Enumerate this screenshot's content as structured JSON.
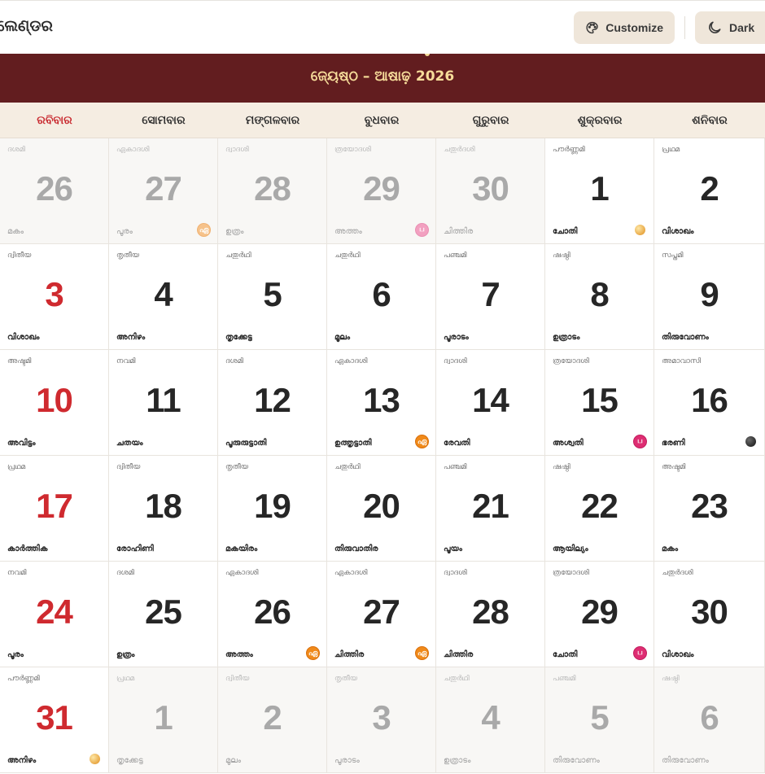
{
  "app": {
    "title": "ଲେଣ୍ଡର"
  },
  "toolbar": {
    "customize_label": "Customize",
    "customize_icon": "palette-icon",
    "dark_label": "Dark",
    "dark_icon": "moon-icon"
  },
  "month": {
    "title": "ଜ୍ୟେଷ୍ଠ – ଆଷାଢ଼ 2026"
  },
  "weekdays": [
    "ରବିବାର",
    "ସୋମବାର",
    "ମଙ୍ଗଳବାର",
    "ବୁଧବାର",
    "ଗୁରୁବାର",
    "ଶୁକ୍ରବାର",
    "ଶନିବାର"
  ],
  "colors": {
    "header_bg": "#621d1f",
    "header_text": "#f6dc9a",
    "sunday": "#cf2a2f",
    "weekday_bar": "#f5ede2",
    "badge_orange": "#f08a1a",
    "badge_pink": "#de2d72"
  },
  "days": [
    {
      "tithi": "ദശമി",
      "day": "26",
      "nakshatra": "മകം",
      "other": true
    },
    {
      "tithi": "ഏകാദശി",
      "day": "27",
      "nakshatra": "പൂരം",
      "other": true,
      "badge": {
        "text": "ഏ",
        "color": "orange"
      }
    },
    {
      "tithi": "ദ്വാദശി",
      "day": "28",
      "nakshatra": "ഉത്രം",
      "other": true
    },
    {
      "tithi": "ത്രയോദശി",
      "day": "29",
      "nakshatra": "അത്തം",
      "other": true,
      "badge": {
        "text": "ப",
        "color": "pink"
      }
    },
    {
      "tithi": "ചതുർദശി",
      "day": "30",
      "nakshatra": "ചിത്തിര",
      "other": true
    },
    {
      "tithi": "പൗർണ്ണമി",
      "day": "1",
      "nakshatra": "ചോതി",
      "moon": "full"
    },
    {
      "tithi": "പ്രഥമ",
      "day": "2",
      "nakshatra": "വിശാഖം"
    },
    {
      "tithi": "ദ്വിതീയ",
      "day": "3",
      "nakshatra": "വിശാഖം"
    },
    {
      "tithi": "തൃതീയ",
      "day": "4",
      "nakshatra": "അനിഴം"
    },
    {
      "tithi": "ചതുർഥി",
      "day": "5",
      "nakshatra": "തൃക്കേട്ട"
    },
    {
      "tithi": "ചതുർഥി",
      "day": "6",
      "nakshatra": "മൂലം"
    },
    {
      "tithi": "പഞ്ചമി",
      "day": "7",
      "nakshatra": "പൂരാടം"
    },
    {
      "tithi": "ഷഷ്ഠി",
      "day": "8",
      "nakshatra": "ഉത്രാടം"
    },
    {
      "tithi": "സപ്തമി",
      "day": "9",
      "nakshatra": "തിരുവോണം"
    },
    {
      "tithi": "അഷ്ടമി",
      "day": "10",
      "nakshatra": "അവിട്ടം"
    },
    {
      "tithi": "നവമി",
      "day": "11",
      "nakshatra": "ചതയം"
    },
    {
      "tithi": "ദശമി",
      "day": "12",
      "nakshatra": "പൂരുരുട്ടാതി"
    },
    {
      "tithi": "ഏകാദശി",
      "day": "13",
      "nakshatra": "ഉത്തൃട്ടാതി",
      "badge": {
        "text": "ഏ",
        "color": "orange"
      }
    },
    {
      "tithi": "ദ്വാദശി",
      "day": "14",
      "nakshatra": "രേവതി"
    },
    {
      "tithi": "ത്രയോദശി",
      "day": "15",
      "nakshatra": "അശ്വതി",
      "badge": {
        "text": "ப",
        "color": "pink"
      }
    },
    {
      "tithi": "അമാവാസി",
      "day": "16",
      "nakshatra": "ഭരണി",
      "moon": "new"
    },
    {
      "tithi": "പ്രഥമ",
      "day": "17",
      "nakshatra": "കാർത്തിക"
    },
    {
      "tithi": "ദ്വിതീയ",
      "day": "18",
      "nakshatra": "രോഹിണി"
    },
    {
      "tithi": "തൃതീയ",
      "day": "19",
      "nakshatra": "മകയിരം"
    },
    {
      "tithi": "ചതുർഥി",
      "day": "20",
      "nakshatra": "തിരുവാതിര"
    },
    {
      "tithi": "പഞ്ചമി",
      "day": "21",
      "nakshatra": "പൂയം"
    },
    {
      "tithi": "ഷഷ്ഠി",
      "day": "22",
      "nakshatra": "ആയില്യം"
    },
    {
      "tithi": "അഷ്ടമി",
      "day": "23",
      "nakshatra": "മകം"
    },
    {
      "tithi": "നവമി",
      "day": "24",
      "nakshatra": "പൂരം"
    },
    {
      "tithi": "ദശമി",
      "day": "25",
      "nakshatra": "ഉത്രം"
    },
    {
      "tithi": "ഏകാദശി",
      "day": "26",
      "nakshatra": "അത്തം",
      "badge": {
        "text": "ഏ",
        "color": "orange"
      }
    },
    {
      "tithi": "ഏകാദശി",
      "day": "27",
      "nakshatra": "ചിത്തിര",
      "badge": {
        "text": "ഏ",
        "color": "orange"
      }
    },
    {
      "tithi": "ദ്വാദശി",
      "day": "28",
      "nakshatra": "ചിത്തിര"
    },
    {
      "tithi": "ത്രയോദശി",
      "day": "29",
      "nakshatra": "ചോതി",
      "badge": {
        "text": "ப",
        "color": "pink"
      }
    },
    {
      "tithi": "ചതുർദശി",
      "day": "30",
      "nakshatra": "വിശാഖം"
    },
    {
      "tithi": "പൗർണ്ണമി",
      "day": "31",
      "nakshatra": "അനിഴം",
      "moon": "full"
    },
    {
      "tithi": "പ്രഥമ",
      "day": "1",
      "nakshatra": "തൃക്കേട്ട",
      "other": true
    },
    {
      "tithi": "ദ്വിതീയ",
      "day": "2",
      "nakshatra": "മൂലം",
      "other": true
    },
    {
      "tithi": "തൃതീയ",
      "day": "3",
      "nakshatra": "പൂരാടം",
      "other": true
    },
    {
      "tithi": "ചതുർഥി",
      "day": "4",
      "nakshatra": "ഉത്രാടം",
      "other": true
    },
    {
      "tithi": "പഞ്ചമി",
      "day": "5",
      "nakshatra": "തിരുവോണം",
      "other": true
    },
    {
      "tithi": "ഷഷ്ഠി",
      "day": "6",
      "nakshatra": "തിരുവോണം",
      "other": true
    }
  ]
}
